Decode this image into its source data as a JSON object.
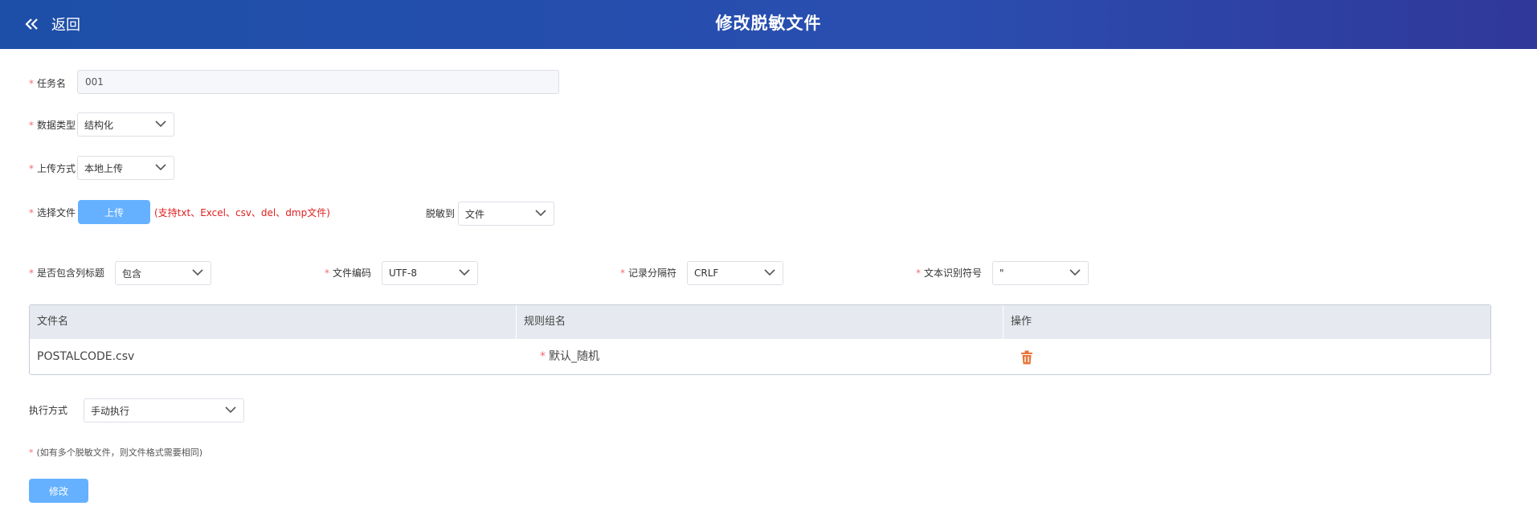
{
  "header": {
    "back_label": "返回",
    "title": "修改脱敏文件"
  },
  "form": {
    "task_name": {
      "label": "任务名",
      "value": "001"
    },
    "data_type": {
      "label": "数据类型",
      "value": "结构化"
    },
    "upload_method": {
      "label": "上传方式",
      "value": "本地上传"
    },
    "select_file": {
      "label": "选择文件",
      "button": "上传",
      "hint": "(支持txt、Excel、csv、del、dmp文件)"
    },
    "desensitize_to": {
      "label": "脱敏到",
      "value": "文件"
    },
    "include_header": {
      "label": "是否包含列标题",
      "value": "包含"
    },
    "file_encoding": {
      "label": "文件编码",
      "value": "UTF-8"
    },
    "record_separator": {
      "label": "记录分隔符",
      "value": "CRLF"
    },
    "text_qualifier": {
      "label": "文本识别符号",
      "value": "\""
    }
  },
  "table": {
    "headers": [
      "文件名",
      "规则组名",
      "操作"
    ],
    "rows": [
      {
        "file_name": "POSTALCODE.csv",
        "rule_group": "默认_随机"
      }
    ]
  },
  "execution": {
    "label": "执行方式",
    "value": "手动执行"
  },
  "footnote": "(如有多个脱敏文件，则文件格式需要相同)",
  "submit_label": "修改",
  "colors": {
    "header_start": "#1d4fa8",
    "header_end": "#30389a",
    "primary_button": "#66b1ff",
    "required": "#f56c6c",
    "hint_red": "#e02020",
    "delete_icon": "#e8763a"
  }
}
